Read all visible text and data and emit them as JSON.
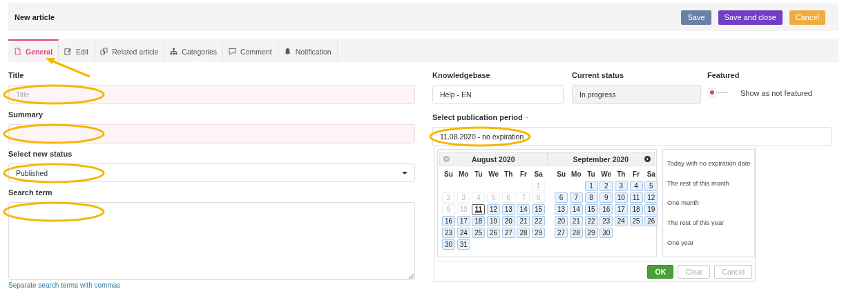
{
  "header": {
    "title": "New article",
    "buttons": [
      {
        "label": "Save",
        "kind": "secondary"
      },
      {
        "label": "Save and close",
        "kind": "primary"
      },
      {
        "label": "Cancel",
        "kind": "warning"
      }
    ]
  },
  "tabs": [
    {
      "label": "General",
      "selected": true,
      "annotated": true
    },
    {
      "label": "Edit",
      "selected": false,
      "annotated": false
    },
    {
      "label": "Related article",
      "selected": false,
      "annotated": false
    },
    {
      "label": "Categories",
      "selected": false,
      "annotated": false
    },
    {
      "label": "Comment",
      "selected": false,
      "annotated": false
    },
    {
      "label": "Notification",
      "selected": false,
      "annotated": false
    }
  ],
  "fields": [
    {
      "kind": "input",
      "label": "Title",
      "placeholder": "Title",
      "required": true,
      "annotated": true
    },
    {
      "kind": "input",
      "label": "Summary",
      "required": true,
      "annotated": true
    },
    {
      "kind": "select",
      "label": "Select new status",
      "value": "Published",
      "required": false,
      "annotated": true
    },
    {
      "kind": "textarea",
      "label": "Search term",
      "hint": "Separate search terms with commas",
      "required": false,
      "annotated": true
    }
  ],
  "knowledgebase": {
    "label": "Knowledgebase",
    "value": "Help - EN",
    "disabled": false
  },
  "current_status": {
    "label": "Current status",
    "value": "In progress",
    "disabled": true
  },
  "featured": {
    "label": "Featured",
    "on": false,
    "text": "Show as not featured"
  },
  "publication": {
    "label": "Select publication period",
    "suffix": "-",
    "value": "11.08.2020 - no expiration",
    "annotated": true,
    "picker": {
      "prev": {
        "disabled": true
      },
      "next": {
        "disabled": false
      },
      "months": [
        {
          "title": "August 2020",
          "weekdays": [
            "Su",
            "Mo",
            "Tu",
            "We",
            "Th",
            "Fr",
            "Sa"
          ],
          "weeks": [
            [
              {
                "kind": "blank"
              },
              {
                "kind": "blank"
              },
              {
                "kind": "blank"
              },
              {
                "kind": "blank"
              },
              {
                "kind": "blank"
              },
              {
                "kind": "blank"
              },
              {
                "d": "1",
                "disabled": true,
                "today": false
              }
            ],
            [
              {
                "d": "2",
                "disabled": true,
                "today": false
              },
              {
                "d": "3",
                "disabled": true,
                "today": false
              },
              {
                "d": "4",
                "disabled": true,
                "today": false
              },
              {
                "d": "5",
                "disabled": true,
                "today": false
              },
              {
                "d": "6",
                "disabled": true,
                "today": false
              },
              {
                "d": "7",
                "disabled": true,
                "today": false
              },
              {
                "d": "8",
                "disabled": true,
                "today": false
              }
            ],
            [
              {
                "d": "9",
                "disabled": true,
                "today": false
              },
              {
                "d": "10",
                "disabled": true,
                "today": false
              },
              {
                "d": "11",
                "disabled": false,
                "today": true
              },
              {
                "d": "12",
                "disabled": false,
                "today": false
              },
              {
                "d": "13",
                "disabled": false,
                "today": false
              },
              {
                "d": "14",
                "disabled": false,
                "today": false
              },
              {
                "d": "15",
                "disabled": false,
                "today": false
              }
            ],
            [
              {
                "d": "16",
                "disabled": false,
                "today": false
              },
              {
                "d": "17",
                "disabled": false,
                "today": false
              },
              {
                "d": "18",
                "disabled": false,
                "today": false
              },
              {
                "d": "19",
                "disabled": false,
                "today": false
              },
              {
                "d": "20",
                "disabled": false,
                "today": false
              },
              {
                "d": "21",
                "disabled": false,
                "today": false
              },
              {
                "d": "22",
                "disabled": false,
                "today": false
              }
            ],
            [
              {
                "d": "23",
                "disabled": false,
                "today": false
              },
              {
                "d": "24",
                "disabled": false,
                "today": false
              },
              {
                "d": "25",
                "disabled": false,
                "today": false
              },
              {
                "d": "26",
                "disabled": false,
                "today": false
              },
              {
                "d": "27",
                "disabled": false,
                "today": false
              },
              {
                "d": "28",
                "disabled": false,
                "today": false
              },
              {
                "d": "29",
                "disabled": false,
                "today": false
              }
            ],
            [
              {
                "d": "30",
                "disabled": false,
                "today": false
              },
              {
                "d": "31",
                "disabled": false,
                "today": false
              }
            ]
          ]
        },
        {
          "title": "September 2020",
          "weekdays": [
            "Su",
            "Mo",
            "Tu",
            "We",
            "Th",
            "Fr",
            "Sa"
          ],
          "weeks": [
            [
              {
                "kind": "blank"
              },
              {
                "kind": "blank"
              },
              {
                "d": "1",
                "disabled": false,
                "today": false
              },
              {
                "d": "2",
                "disabled": false,
                "today": false
              },
              {
                "d": "3",
                "disabled": false,
                "today": false
              },
              {
                "d": "4",
                "disabled": false,
                "today": false
              },
              {
                "d": "5",
                "disabled": false,
                "today": false
              }
            ],
            [
              {
                "d": "6",
                "disabled": false,
                "today": false
              },
              {
                "d": "7",
                "disabled": false,
                "today": false
              },
              {
                "d": "8",
                "disabled": false,
                "today": false
              },
              {
                "d": "9",
                "disabled": false,
                "today": false
              },
              {
                "d": "10",
                "disabled": false,
                "today": false
              },
              {
                "d": "11",
                "disabled": false,
                "today": false
              },
              {
                "d": "12",
                "disabled": false,
                "today": false
              }
            ],
            [
              {
                "d": "13",
                "disabled": false,
                "today": false
              },
              {
                "d": "14",
                "disabled": false,
                "today": false
              },
              {
                "d": "15",
                "disabled": false,
                "today": false
              },
              {
                "d": "16",
                "disabled": false,
                "today": false
              },
              {
                "d": "17",
                "disabled": false,
                "today": false
              },
              {
                "d": "18",
                "disabled": false,
                "today": false
              },
              {
                "d": "19",
                "disabled": false,
                "today": false
              }
            ],
            [
              {
                "d": "20",
                "disabled": false,
                "today": false
              },
              {
                "d": "21",
                "disabled": false,
                "today": false
              },
              {
                "d": "22",
                "disabled": false,
                "today": false
              },
              {
                "d": "23",
                "disabled": false,
                "today": false
              },
              {
                "d": "24",
                "disabled": false,
                "today": false
              },
              {
                "d": "25",
                "disabled": false,
                "today": false
              },
              {
                "d": "26",
                "disabled": false,
                "today": false
              }
            ],
            [
              {
                "d": "27",
                "disabled": false,
                "today": false
              },
              {
                "d": "28",
                "disabled": false,
                "today": false
              },
              {
                "d": "29",
                "disabled": false,
                "today": false
              },
              {
                "d": "30",
                "disabled": false,
                "today": false
              }
            ]
          ]
        }
      ],
      "ranges": [
        "Today with no expiration date",
        "The rest of this month",
        "One month",
        "The rest of this year",
        "One year"
      ],
      "buttons": [
        {
          "label": "OK",
          "kind": "ok",
          "disabled": false
        },
        {
          "label": "Clear",
          "kind": "plain",
          "disabled": true
        },
        {
          "label": "Cancel",
          "kind": "plain",
          "disabled": true
        }
      ]
    }
  }
}
